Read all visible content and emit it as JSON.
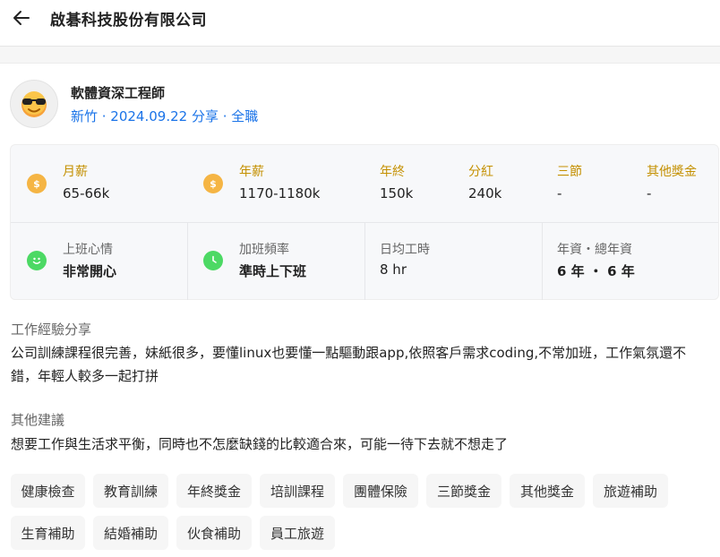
{
  "header": {
    "company": "啟碁科技股份有限公司"
  },
  "post": {
    "title": "軟體資深工程師",
    "meta": "新竹 · 2024.09.22 分享 · 全職"
  },
  "stats_row1": [
    {
      "label": "月薪",
      "value": "65-66k",
      "icon": "dollar-icon"
    },
    {
      "label": "年薪",
      "value": "1170-1180k",
      "icon": "dollar-icon"
    },
    {
      "label": "年終",
      "value": "150k"
    },
    {
      "label": "分紅",
      "value": "240k"
    },
    {
      "label": "三節",
      "value": "-"
    },
    {
      "label": "其他獎金",
      "value": "-"
    }
  ],
  "stats_row2": [
    {
      "label": "上班心情",
      "value": "非常開心",
      "icon": "smile-icon"
    },
    {
      "label": "加班頻率",
      "value": "準時上下班",
      "icon": "clock-icon"
    },
    {
      "label": "日均工時",
      "value": "8 hr"
    },
    {
      "label": "年資・總年資",
      "value": "6 年 ・ 6 年"
    }
  ],
  "experience": {
    "title": "工作經驗分享",
    "text": "公司訓練課程很完善，妹紙很多，要懂linux也要懂一點驅動跟app,依照客戶需求coding,不常加班，工作氣氛還不錯，年輕人較多一起打拼"
  },
  "advice": {
    "title": "其他建議",
    "text": "想要工作與生活求平衡，同時也不怎麼缺錢的比較適合來，可能一待下去就不想走了"
  },
  "tags": [
    "健康檢查",
    "教育訓練",
    "年終獎金",
    "培訓課程",
    "團體保險",
    "三節獎金",
    "其他獎金",
    "旅遊補助",
    "生育補助",
    "結婚補助",
    "伙食補助",
    "員工旅遊"
  ],
  "colors": {
    "accent": "#1a73e8",
    "gold": "#c49000",
    "dollar": "#f5b544",
    "green": "#4cd964"
  }
}
